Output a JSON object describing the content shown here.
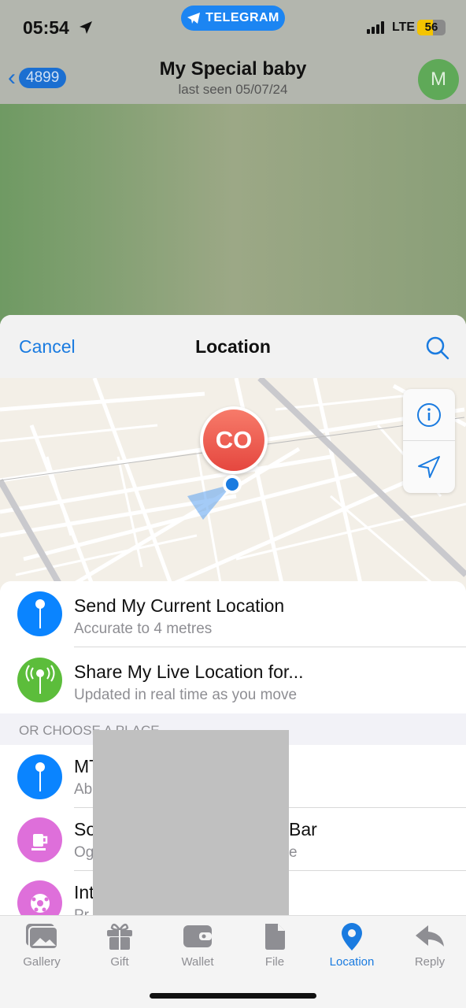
{
  "status_bar": {
    "time": "05:54",
    "app_pill": "TELEGRAM",
    "network": "LTE",
    "battery": "56"
  },
  "chat_header": {
    "back_count": "4899",
    "title": "My Special baby",
    "subtitle": "last seen 05/07/24",
    "avatar_initial": "M"
  },
  "location_sheet": {
    "cancel_label": "Cancel",
    "title": "Location",
    "map": {
      "user_pin_initials": "CO"
    },
    "actions": [
      {
        "title": "Send My Current Location",
        "subtitle": "Accurate to 4 metres",
        "icon": "pin-icon",
        "color": "#0a84ff"
      },
      {
        "title": "Share My Live Location for...",
        "subtitle": "Updated in real time as you move",
        "icon": "live-location-icon",
        "color": "#5cbd3b"
      }
    ],
    "section_header": "OR CHOOSE A PLACE",
    "places": [
      {
        "title": "MT",
        "subtitle": "Ab",
        "icon": "pin-icon",
        "color": "#0a84ff"
      },
      {
        "title": "So",
        "title_end": "Bar",
        "subtitle": "Og",
        "subtitle_end": "e",
        "icon": "beer-mug-icon",
        "color": "#de6fda"
      },
      {
        "title": "Int",
        "subtitle": "Pr",
        "icon": "soccer-ball-icon",
        "color": "#de6fda"
      }
    ]
  },
  "tab_bar": {
    "active": "Location",
    "tabs": [
      {
        "label": "Gallery",
        "icon": "gallery-icon"
      },
      {
        "label": "Gift",
        "icon": "gift-icon"
      },
      {
        "label": "Wallet",
        "icon": "wallet-icon"
      },
      {
        "label": "File",
        "icon": "file-icon"
      },
      {
        "label": "Location",
        "icon": "location-pin-icon"
      },
      {
        "label": "Reply",
        "icon": "reply-icon"
      }
    ]
  }
}
